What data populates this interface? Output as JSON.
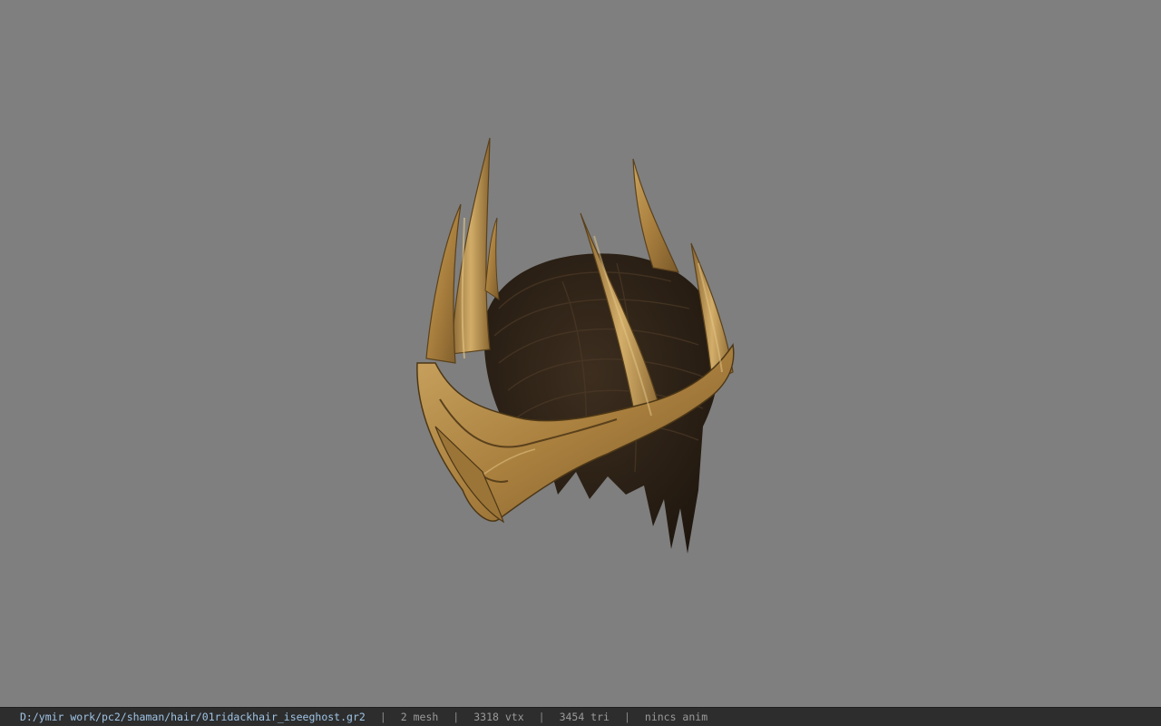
{
  "viewer": {
    "background_color": "#7f7f7f",
    "model_icon": "crown-hair-model-icon"
  },
  "status": {
    "file_path": "D:/ymir work/pc2/shaman/hair/01ridackhair_iseeghost.gr2",
    "separator": "|",
    "mesh": "2 mesh",
    "vertices": "3318 vtx",
    "triangles": "3454 tri",
    "anim": "nincs anim"
  },
  "colors": {
    "statusbar_bg": "#2d2d2d",
    "path_text": "#9fc4e6",
    "info_text": "#9a9a9a",
    "crown_gold": "#b48a47",
    "hair_dark": "#2c2116"
  }
}
